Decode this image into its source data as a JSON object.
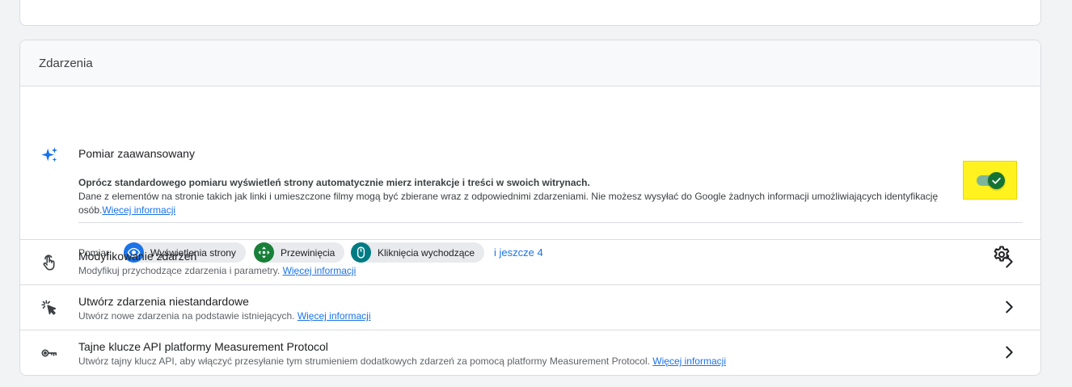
{
  "section": {
    "title": "Zdarzenia"
  },
  "enhanced": {
    "title": "Pomiar zaawansowany",
    "desc_bold": "Oprócz standardowego pomiaru wyświetleń strony automatycznie mierz interakcje i treści w swoich witrynach.",
    "desc": "Dane z elementów na stronie takich jak linki i umieszczone filmy mogą być zbierane wraz z odpowiednimi zdarzeniami. Nie możesz wysyłać do Google żadnych informacji umożliwiających identyfikację osób.",
    "learn_more": "Więcej informacji",
    "toggle_on": true,
    "measure_label": "Pomiar:",
    "chips": [
      {
        "label": "Wyświetlenia strony",
        "icon": "eye-icon",
        "color": "#1a73e8"
      },
      {
        "label": "Przewinięcia",
        "icon": "scroll-arrows-icon",
        "color": "#188038"
      },
      {
        "label": "Kliknięcia wychodzące",
        "icon": "mouse-icon",
        "color": "#007b83"
      }
    ],
    "more": "i jeszcze 4"
  },
  "rows": [
    {
      "title": "Modyfikowanie zdarzeń",
      "desc": "Modyfikuj przychodzące zdarzenia i parametry.",
      "link": "Więcej informacji",
      "icon": "touch-hand-icon"
    },
    {
      "title": "Utwórz zdarzenia niestandardowe",
      "desc": "Utwórz nowe zdarzenia na podstawie istniejących.",
      "link": "Więcej informacji",
      "icon": "cursor-click-icon"
    },
    {
      "title": "Tajne klucze API platformy Measurement Protocol",
      "desc": "Utwórz tajny klucz API, aby włączyć przesyłanie tym strumieniem dodatkowych zdarzeń za pomocą platformy Measurement Protocol.",
      "link": "Więcej informacji",
      "icon": "key-icon"
    }
  ],
  "colors": {
    "accent": "#1a73e8",
    "toggle_thumb": "#137333",
    "toggle_track": "#7cb59a",
    "highlight": "#fff21f"
  }
}
